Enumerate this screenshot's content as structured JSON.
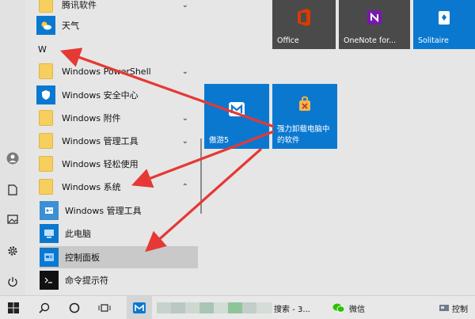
{
  "app_list": {
    "top_truncated": "腾讯软件",
    "weather": "天气",
    "letter_w": "W",
    "items": [
      {
        "label": "Windows PowerShell"
      },
      {
        "label": "Windows 安全中心"
      },
      {
        "label": "Windows 附件"
      },
      {
        "label": "Windows 管理工具"
      },
      {
        "label": "Windows 轻松使用"
      },
      {
        "label": "Windows 系统"
      }
    ],
    "subitems": [
      {
        "label": "Windows 管理工具"
      },
      {
        "label": "此电脑"
      },
      {
        "label": "控制面板"
      },
      {
        "label": "命令提示符"
      }
    ]
  },
  "tiles": {
    "office": "Office",
    "onenote": "OneNote for...",
    "solitaire": "Solitaire",
    "aoyou": "傲游5",
    "uninstall": "强力卸载电脑中的软件"
  },
  "taskbar": {
    "search_item": "搜索 - 3...",
    "wechat": "微信",
    "control": "控制"
  },
  "colors": {
    "tile_blue": "#0b78d0",
    "arrow_red": "#e53935",
    "office_red": "#d83b01",
    "onenote_purple": "#7719aa"
  }
}
